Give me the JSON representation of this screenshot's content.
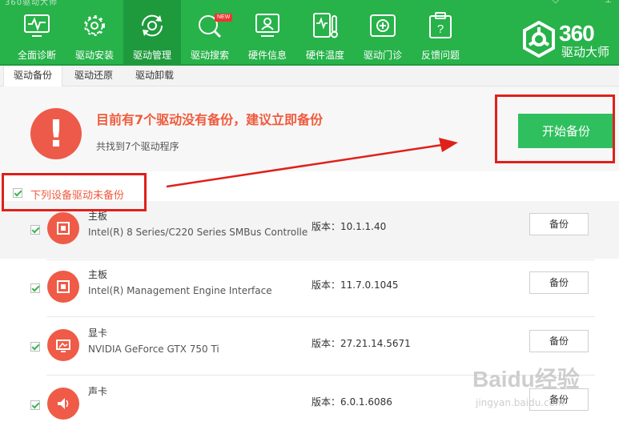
{
  "window": {
    "title": "360驱动大师"
  },
  "nav": {
    "items": [
      {
        "label": "全面诊断",
        "icon": "monitor-pulse-icon"
      },
      {
        "label": "驱动安装",
        "icon": "gear-icon"
      },
      {
        "label": "驱动管理",
        "icon": "refresh-gear-icon",
        "active": true
      },
      {
        "label": "驱动搜索",
        "icon": "search-icon",
        "badge": "NEW"
      },
      {
        "label": "硬件信息",
        "icon": "monitor-user-icon"
      },
      {
        "label": "硬件温度",
        "icon": "thermometer-icon"
      },
      {
        "label": "驱动门诊",
        "icon": "medical-kit-icon"
      },
      {
        "label": "反馈问题",
        "icon": "question-clipboard-icon"
      }
    ]
  },
  "brand": {
    "number": "360",
    "name": "驱动大师"
  },
  "subtabs": [
    {
      "label": "驱动备份",
      "active": true
    },
    {
      "label": "驱动还原"
    },
    {
      "label": "驱动卸载"
    }
  ],
  "alert": {
    "mark": "!",
    "title": "目前有7个驱动没有备份，建议立即备份",
    "subtitle": "共找到7个驱动程序",
    "start_button": "开始备份"
  },
  "section": {
    "label": "下列设备驱动未备份"
  },
  "devices": [
    {
      "category": "主板",
      "name": "Intel(R) 8 Series/C220 Series SMBus Controlle",
      "version": "版本：10.1.1.40",
      "button": "备份",
      "icon": "chip-icon"
    },
    {
      "category": "主板",
      "name": "Intel(R) Management Engine Interface",
      "version": "版本：11.7.0.1045",
      "button": "备份",
      "icon": "chip-icon"
    },
    {
      "category": "显卡",
      "name": "NVIDIA GeForce GTX 750 Ti",
      "version": "版本：27.21.14.5671",
      "button": "备份",
      "icon": "display-icon"
    },
    {
      "category": "声卡",
      "name": "",
      "version": "版本：6.0.1.6086",
      "button": "备份",
      "icon": "speaker-icon"
    }
  ],
  "watermark": {
    "text": "Baidu经验",
    "url": "jingyan.baidu.com"
  },
  "colors": {
    "brand_green": "#27b24a",
    "alert_red": "#ee5a49",
    "start_green": "#2fbf5e",
    "annotation_red": "#e0201a"
  }
}
